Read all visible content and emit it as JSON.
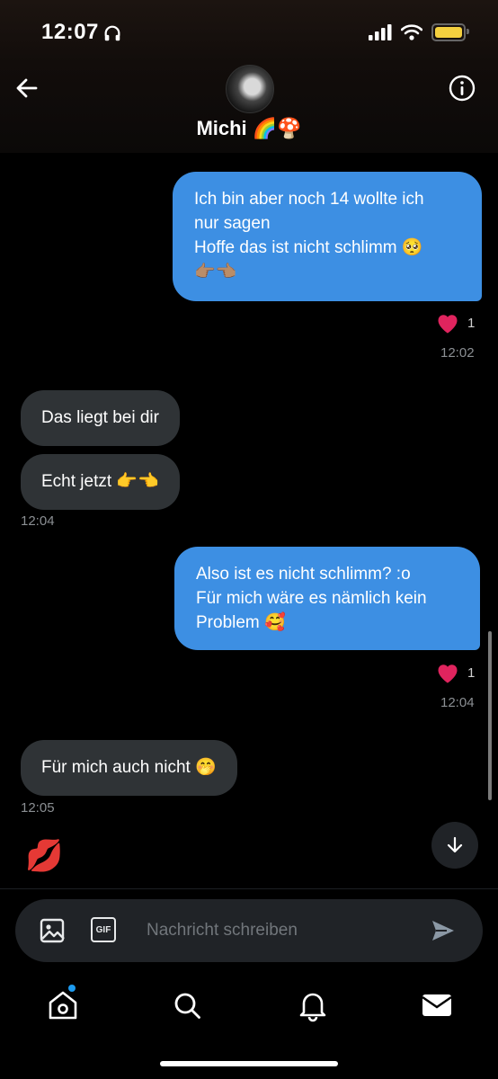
{
  "status": {
    "time": "12:07"
  },
  "header": {
    "name": "Michi 🌈🍄"
  },
  "messages": {
    "m1_line1": "Ich bin aber noch 14 wollte ich",
    "m1_line2": "nur sagen",
    "m1_line3": "Hoffe das ist nicht schlimm 🥺",
    "m1_line4": "👉🏽👈🏽",
    "m1_likes": "1",
    "m1_time": "12:02",
    "m2_text": "Das liegt bei dir",
    "m3_text": "Echt jetzt 👉👈",
    "m3_time": "12:04",
    "m4_line1": "Also ist es nicht schlimm? :o",
    "m4_line2": "Für mich wäre es nämlich kein",
    "m4_line3": "Problem 🥰",
    "m4_likes": "1",
    "m4_time": "12:04",
    "m5_text": "Für mich auch nicht 🤭",
    "m5_time": "12:05",
    "m6_text": "💋"
  },
  "composer": {
    "placeholder": "Nachricht schreiben",
    "gif_label": "GIF"
  },
  "colors": {
    "accent": "#1d9bf0",
    "outgoing_bubble": "#3d8fe3",
    "incoming_bubble": "#2f3336",
    "heart": "#e0245e"
  },
  "icons": {
    "back": "arrow-left-icon",
    "info": "info-icon",
    "image": "image-icon",
    "gif": "gif-icon",
    "send": "send-icon",
    "home": "home-icon",
    "search": "search-icon",
    "bell": "bell-icon",
    "mail": "mail-icon",
    "down": "arrow-down-icon"
  }
}
